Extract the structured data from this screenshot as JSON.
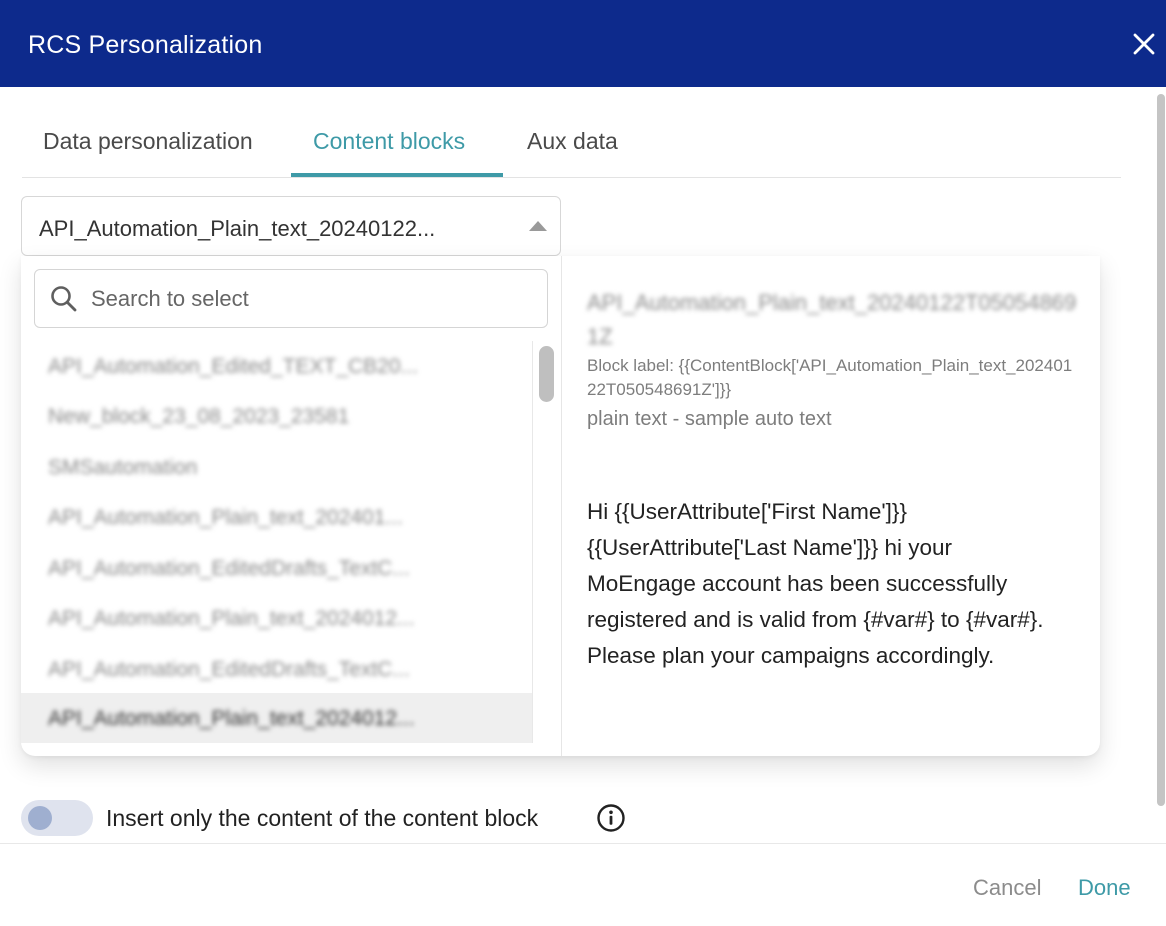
{
  "dialog": {
    "title": "RCS Personalization"
  },
  "tabs": [
    {
      "label": "Data personalization"
    },
    {
      "label": "Content blocks"
    },
    {
      "label": "Aux data"
    }
  ],
  "active_tab": "Content blocks",
  "select": {
    "value": "API_Automation_Plain_text_20240122..."
  },
  "search": {
    "placeholder": "Search to select"
  },
  "list_items": [
    {
      "label": "API_Automation_Edited_TEXT_CB20..."
    },
    {
      "label": "New_block_23_08_2023_23581"
    },
    {
      "label": "SMSautomation"
    },
    {
      "label": "API_Automation_Plain_text_202401..."
    },
    {
      "label": "API_Automation_EditedDrafts_TextC..."
    },
    {
      "label": "API_Automation_Plain_text_2024012..."
    },
    {
      "label": "API_Automation_EditedDrafts_TextC..."
    },
    {
      "label": "API_Automation_Plain_text_2024012..."
    }
  ],
  "selected_index": 7,
  "preview": {
    "name": "API_Automation_Plain_text_20240122T050548691Z",
    "block_label": "Block label: {{ContentBlock['API_Automation_Plain_text_20240122T050548691Z']}}",
    "description": "plain text - sample auto text",
    "content": "Hi {{UserAttribute['First Name']}} {{UserAttribute['Last Name']}} hi your MoEngage account has been successfully registered and is valid from {#var#} to {#var#}. Please plan your campaigns accordingly."
  },
  "toggle": {
    "label": "Insert only the content of the content block",
    "on": false
  },
  "footer": {
    "cancel_label": "Cancel",
    "done_label": "Done"
  },
  "colors": {
    "header_bg": "#0d2a8c",
    "accent": "#3e9aa7"
  },
  "icons": [
    "close-icon",
    "chevron-up-icon",
    "search-icon",
    "info-icon"
  ]
}
